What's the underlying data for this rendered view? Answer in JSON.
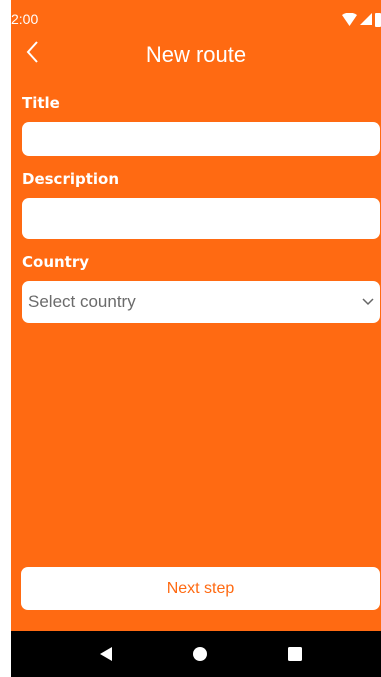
{
  "status_bar": {
    "time": "2:00",
    "icons": [
      "wifi-icon",
      "signal-icon",
      "battery-icon"
    ]
  },
  "app_bar": {
    "title": "New route",
    "back_icon": "chevron-left-icon"
  },
  "form": {
    "title_label": "Title",
    "title_value": "",
    "description_label": "Description",
    "description_value": "",
    "country_label": "Country",
    "country_placeholder": "Select country"
  },
  "actions": {
    "next_label": "Next step"
  },
  "nav_bar": {
    "icons": [
      "back-triangle-icon",
      "home-circle-icon",
      "recents-square-icon"
    ]
  },
  "colors": {
    "primary": "#FF6A12",
    "surface": "#FFFFFF",
    "nav": "#000000"
  }
}
